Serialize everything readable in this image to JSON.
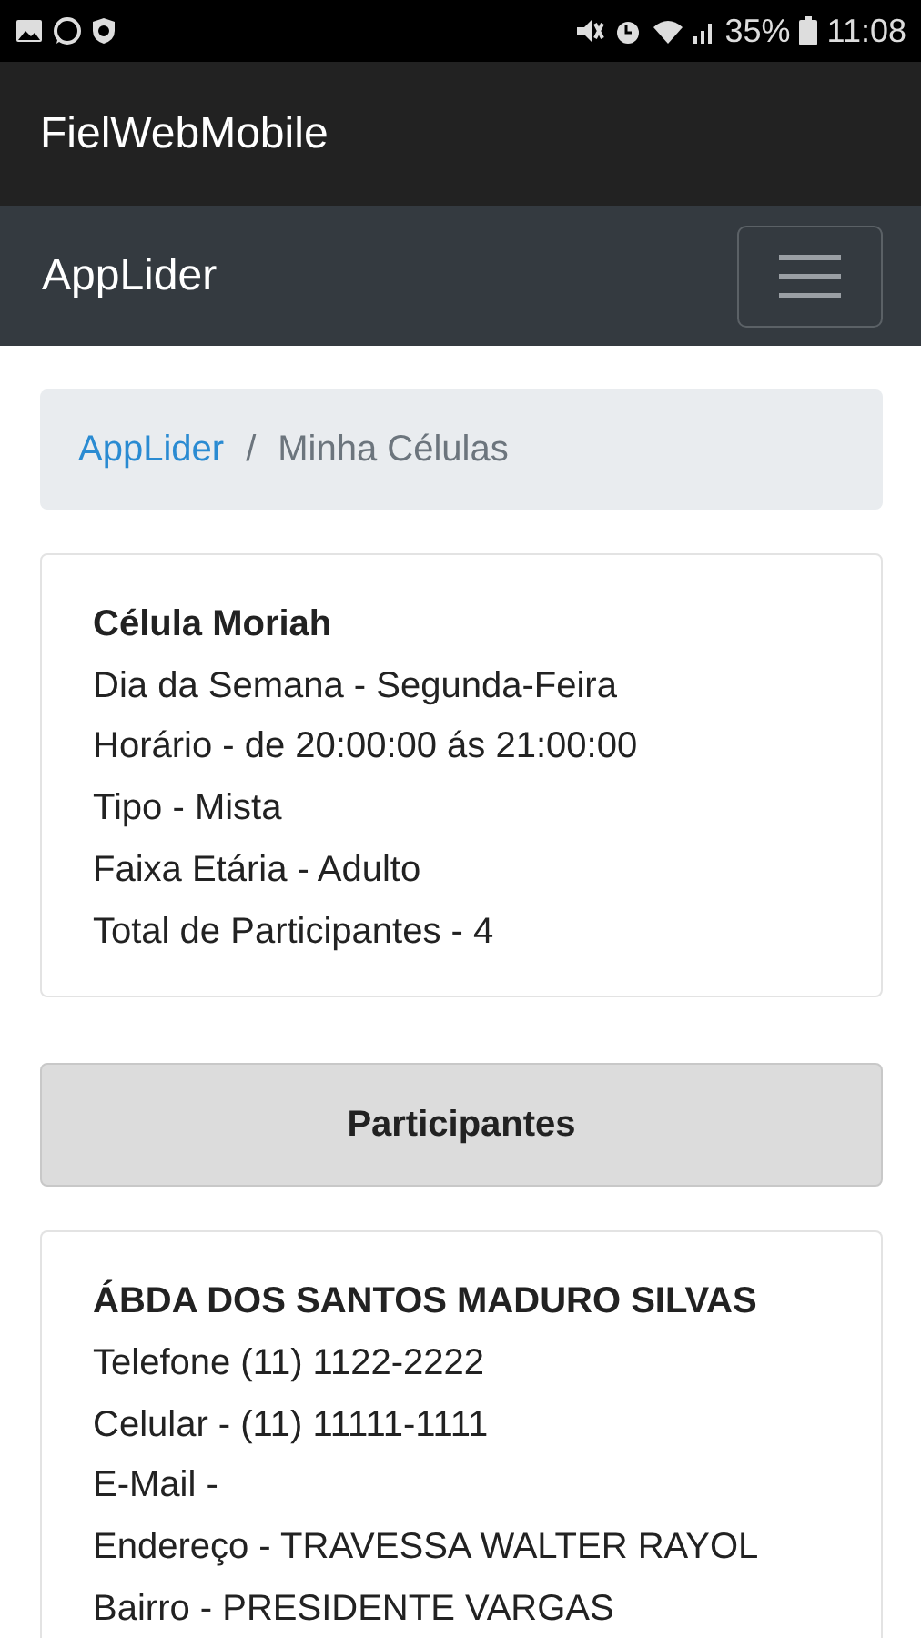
{
  "status_bar": {
    "battery": "35%",
    "time": "11:08"
  },
  "app_bar": {
    "title": "FielWebMobile"
  },
  "navbar": {
    "brand": "AppLider"
  },
  "breadcrumb_separator": "/",
  "breadcrumb": [
    {
      "label": "AppLider",
      "link": true
    },
    {
      "label": "Minha Células",
      "link": false
    }
  ],
  "cell_card": {
    "title": "Célula Moriah",
    "lines": [
      "Dia da Semana - Segunda-Feira",
      "Horário - de 20:00:00 ás 21:00:00",
      "Tipo - Mista",
      "Faixa Etária - Adulto",
      "Total de Participantes - 4"
    ]
  },
  "participants_header": "Participantes",
  "participants": [
    {
      "name": "ÁBDA DOS SANTOS MADURO SILVAS",
      "lines": [
        "Telefone (11) 1122-2222",
        "Celular - (11) 11111-1111",
        "E-Mail -",
        "Endereço - TRAVESSA WALTER RAYOL",
        "Bairro - PRESIDENTE VARGAS"
      ]
    }
  ]
}
